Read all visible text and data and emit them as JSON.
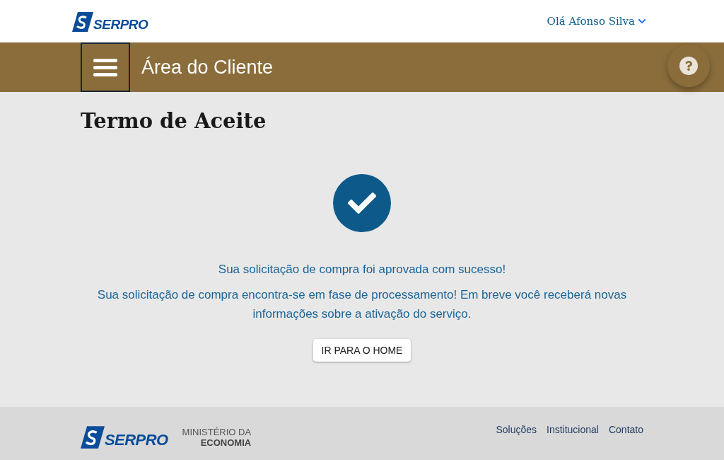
{
  "header": {
    "logo": "SERPRO",
    "user_menu": "Olá Afonso Silva"
  },
  "nav_bar": {
    "title": "Área do Cliente"
  },
  "page": {
    "title": "Termo de Aceite",
    "message": "Sua solicitação de compra foi aprovada com sucesso!",
    "detail": "Sua solicitação de compra encontra-se em fase de processamento! Em breve você receberá novas informações sobre a ativação do serviço.",
    "button": "IR PARA O HOME"
  },
  "footer": {
    "logo": "SERPRO",
    "ministry_line_1": "MINISTÉRIO DA",
    "ministry_line_2": "ECONOMIA",
    "links": [
      {
        "label": "Soluções"
      },
      {
        "label": "Institucional"
      },
      {
        "label": "Contato"
      }
    ]
  }
}
